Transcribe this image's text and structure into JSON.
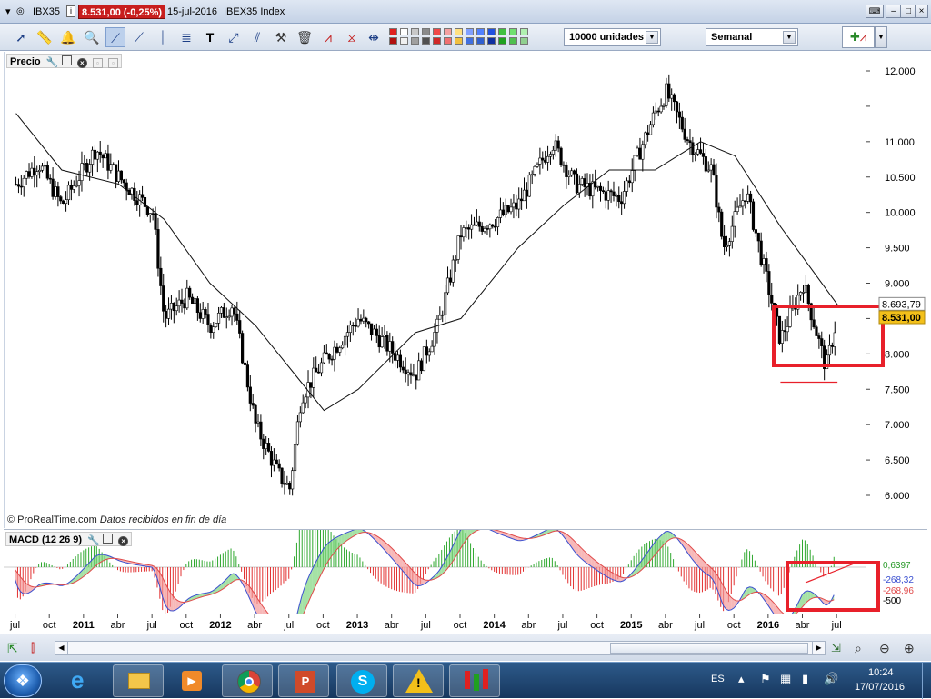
{
  "window": {
    "symbol": "IBX35",
    "price_badge": "8.531,00 (-0,25%)",
    "date": "15-jul-2016",
    "instrument": "IBEX35 Index"
  },
  "toolbar": {
    "quantity_select": "10000 unidades",
    "period_select": "Semanal"
  },
  "price_panel": {
    "title": "Precio",
    "last_value_label": "8.531,00",
    "ma_value_label": "8.693,79",
    "copyright": "© ProRealTime.com",
    "copyright_note": "Datos recibidos en fin de día"
  },
  "macd_panel": {
    "title": "MACD (12 26 9)",
    "histogram_label": "0,6397",
    "macd_label": "-268,32",
    "signal_label": "-268,96",
    "axis_label": "-500"
  },
  "taskbar": {
    "language": "ES",
    "time": "10:24",
    "date": "17/07/2016"
  },
  "colors": {
    "up": "#2fa82f",
    "down": "#e23030",
    "annotation": "#e8202a",
    "price_badge": "#c81e1e"
  },
  "chart_data": {
    "type": "candlestick",
    "title": "IBEX35 Index",
    "period": "weekly",
    "y_ticks": [
      12000,
      11500,
      11000,
      10500,
      10000,
      9500,
      9000,
      8500,
      8000,
      7500,
      7000,
      6500,
      6000
    ],
    "y_tick_labels": [
      "12.000",
      "",
      "11.000",
      "10.500",
      "10.000",
      "9.500",
      "9.000",
      "",
      "8.000",
      "7.500",
      "7.000",
      "6.500",
      "6.000"
    ],
    "x_tick_labels": [
      "jul",
      "oct",
      "2011",
      "abr",
      "jul",
      "oct",
      "2012",
      "abr",
      "jul",
      "oct",
      "2013",
      "abr",
      "jul",
      "oct",
      "2014",
      "abr",
      "jul",
      "oct",
      "2015",
      "abr",
      "jul",
      "oct",
      "2016",
      "abr",
      "jul"
    ],
    "close_path": [
      {
        "t": "2010-07",
        "v": 10400
      },
      {
        "t": "2010-09",
        "v": 10700
      },
      {
        "t": "2010-11",
        "v": 10100
      },
      {
        "t": "2011-02",
        "v": 10900
      },
      {
        "t": "2011-04",
        "v": 10500
      },
      {
        "t": "2011-07",
        "v": 10000
      },
      {
        "t": "2011-08",
        "v": 8500
      },
      {
        "t": "2011-10",
        "v": 8800
      },
      {
        "t": "2011-12",
        "v": 8400
      },
      {
        "t": "2012-02",
        "v": 8700
      },
      {
        "t": "2012-04",
        "v": 7000
      },
      {
        "t": "2012-06",
        "v": 6300
      },
      {
        "t": "2012-07",
        "v": 6100
      },
      {
        "t": "2012-08",
        "v": 7400
      },
      {
        "t": "2012-10",
        "v": 7900
      },
      {
        "t": "2013-01",
        "v": 8500
      },
      {
        "t": "2013-03",
        "v": 8200
      },
      {
        "t": "2013-06",
        "v": 7700
      },
      {
        "t": "2013-08",
        "v": 8400
      },
      {
        "t": "2013-10",
        "v": 9700
      },
      {
        "t": "2014-01",
        "v": 9900
      },
      {
        "t": "2014-03",
        "v": 10100
      },
      {
        "t": "2014-06",
        "v": 11000
      },
      {
        "t": "2014-08",
        "v": 10400
      },
      {
        "t": "2014-10",
        "v": 10300
      },
      {
        "t": "2014-12",
        "v": 10200
      },
      {
        "t": "2015-03",
        "v": 11400
      },
      {
        "t": "2015-04",
        "v": 11700
      },
      {
        "t": "2015-06",
        "v": 11000
      },
      {
        "t": "2015-08",
        "v": 10600
      },
      {
        "t": "2015-09",
        "v": 9500
      },
      {
        "t": "2015-11",
        "v": 10300
      },
      {
        "t": "2016-01",
        "v": 8900
      },
      {
        "t": "2016-02",
        "v": 8200
      },
      {
        "t": "2016-04",
        "v": 9000
      },
      {
        "t": "2016-06",
        "v": 7800
      },
      {
        "t": "2016-07",
        "v": 8531
      }
    ],
    "moving_average": {
      "last": 8693.79,
      "points": [
        {
          "t": "2010-07",
          "v": 11400
        },
        {
          "t": "2010-11",
          "v": 10600
        },
        {
          "t": "2011-04",
          "v": 10400
        },
        {
          "t": "2011-08",
          "v": 9900
        },
        {
          "t": "2011-12",
          "v": 9000
        },
        {
          "t": "2012-04",
          "v": 8400
        },
        {
          "t": "2012-08",
          "v": 7600
        },
        {
          "t": "2012-10",
          "v": 7200
        },
        {
          "t": "2013-01",
          "v": 7500
        },
        {
          "t": "2013-06",
          "v": 8300
        },
        {
          "t": "2013-10",
          "v": 8500
        },
        {
          "t": "2014-03",
          "v": 9500
        },
        {
          "t": "2014-07",
          "v": 10100
        },
        {
          "t": "2014-11",
          "v": 10600
        },
        {
          "t": "2015-03",
          "v": 10600
        },
        {
          "t": "2015-07",
          "v": 11000
        },
        {
          "t": "2015-10",
          "v": 10800
        },
        {
          "t": "2016-02",
          "v": 9800
        },
        {
          "t": "2016-07",
          "v": 8694
        }
      ]
    },
    "support_line": {
      "from": "2016-02",
      "to": "2016-07",
      "v": 7600
    },
    "macd": {
      "macd_last": -268.32,
      "signal_last": -268.96,
      "histogram_last": 0.6397,
      "y_tick": -500
    }
  }
}
